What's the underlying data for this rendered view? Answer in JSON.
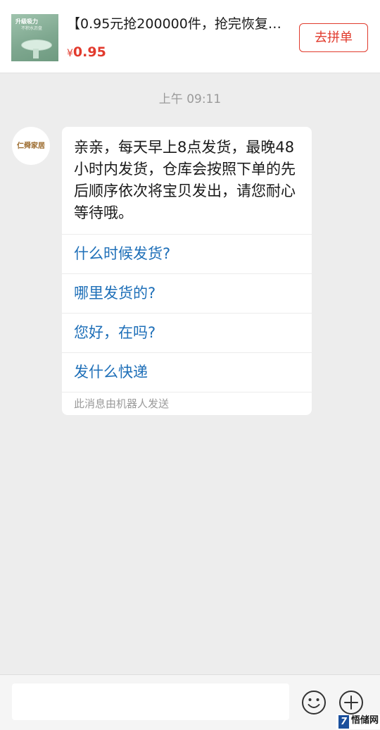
{
  "product": {
    "thumbnail_title": "升级吸力",
    "thumbnail_subtitle": "不积水沥盘",
    "title": "【0.95元抢200000件，抢完恢复…",
    "currency": "¥",
    "price": "0.95",
    "group_buy_label": "去拼单"
  },
  "chat": {
    "timestamp": "上午 09:11",
    "avatar_label": "仁舜家居",
    "message": {
      "text": "亲亲，每天早上8点发货，最晚48小时内发货，仓库会按照下单的先后顺序依次将宝贝发出，请您耐心等待哦。",
      "quick_replies": [
        "什么时候发货?",
        "哪里发货的?",
        "您好，在吗?",
        "发什么快递"
      ],
      "note": "此消息由机器人发送"
    }
  },
  "input_bar": {
    "input_value": "",
    "emoji_icon": "smiley-icon",
    "plus_icon": "plus-circle-icon"
  },
  "watermark": {
    "logo": "7",
    "text": "悟储网"
  },
  "colors": {
    "accent_red": "#e13b2d",
    "link_blue": "#1e6fb8",
    "background": "#ededed"
  }
}
